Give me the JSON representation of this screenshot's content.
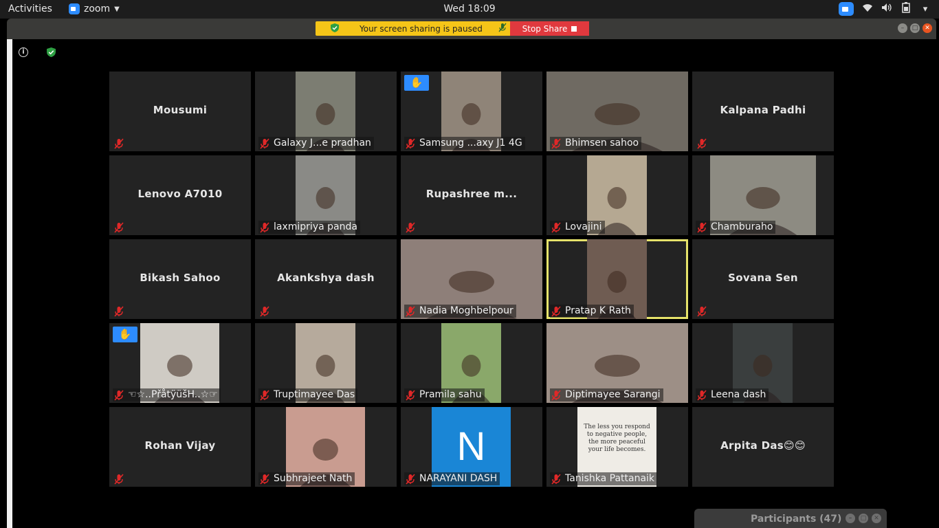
{
  "topbar": {
    "activities": "Activities",
    "app_name": "zoom",
    "clock": "Wed 18:09"
  },
  "sharebar": {
    "paused_text": "Your screen sharing is paused",
    "stop_label": "Stop Share"
  },
  "participants_panel": {
    "title": "Participants (47)"
  },
  "tiles": [
    {
      "name": "Mousumi",
      "mode": "name"
    },
    {
      "name": "Galaxy J...e pradhan",
      "mode": "video",
      "bg": "#7c7d72"
    },
    {
      "name": "Samsung ...axy J1 4G",
      "mode": "video",
      "bg": "#8f8478",
      "hand": true
    },
    {
      "name": "Bhimsen sahoo",
      "mode": "video",
      "bg": "#6f6a62"
    },
    {
      "name": "Kalpana Padhi",
      "mode": "name"
    },
    {
      "name": "Lenovo A7010",
      "mode": "name"
    },
    {
      "name": "laxmipriya panda",
      "mode": "video",
      "bg": "#8a8a86"
    },
    {
      "name": "Rupashree  m...",
      "mode": "name"
    },
    {
      "name": "Lovajini",
      "mode": "video",
      "bg": "#b5a892"
    },
    {
      "name": "Chamburaho",
      "mode": "video",
      "bg": "#8d8b82"
    },
    {
      "name": "Bikash Sahoo",
      "mode": "name"
    },
    {
      "name": "Akankshya dash",
      "mode": "name"
    },
    {
      "name": "Nadia Moghbelpour",
      "mode": "video",
      "bg": "#8e7f79"
    },
    {
      "name": "Pratap K Rath",
      "mode": "video",
      "bg": "#6f5c52",
      "active": true
    },
    {
      "name": "Sovana Sen",
      "mode": "name"
    },
    {
      "name": "☜☆..PřåtÿüšH..☆☞",
      "mode": "video",
      "bg": "#cfcbc4",
      "hand": true
    },
    {
      "name": "Truptimayee Das",
      "mode": "video",
      "bg": "#b6aa9c"
    },
    {
      "name": "Pramila sahu",
      "mode": "video",
      "bg": "#8aa86a"
    },
    {
      "name": "Diptimayee Sarangi",
      "mode": "video",
      "bg": "#9d8f86"
    },
    {
      "name": "Leena dash",
      "mode": "video",
      "bg": "#3a3e3e"
    },
    {
      "name": "Rohan Vijay",
      "mode": "name"
    },
    {
      "name": "Subhrajeet Nath",
      "mode": "video",
      "bg": "#c99c90"
    },
    {
      "name": "NARAYANI DASH",
      "mode": "avatar",
      "initial": "N",
      "bg": "#1a86d6"
    },
    {
      "name": "Tanishka Pattanaik",
      "mode": "quote",
      "bg": "#efece6",
      "quote": "The less you respond to negative people, the more peaceful your life becomes."
    },
    {
      "name": "Arpita Das😊😊",
      "mode": "name",
      "nomute": true
    }
  ]
}
